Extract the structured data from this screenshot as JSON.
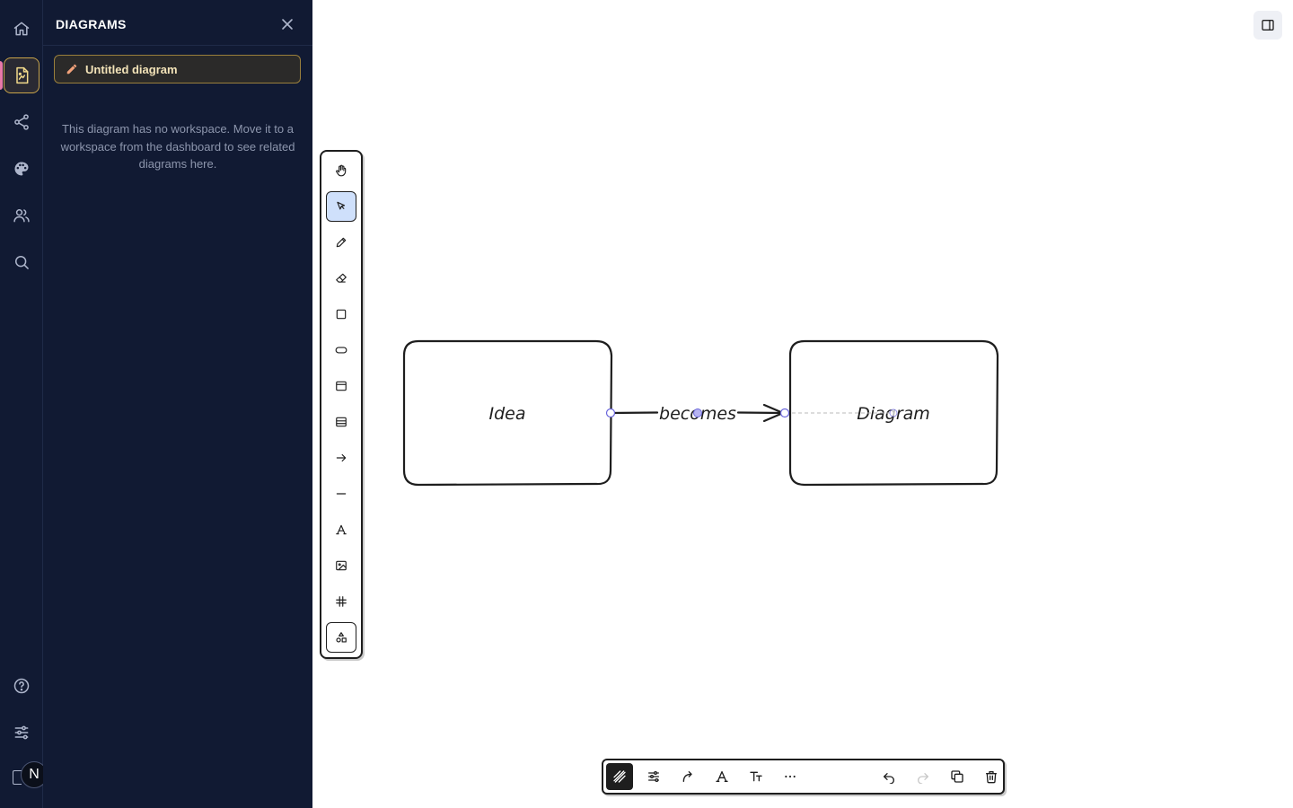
{
  "panel": {
    "title": "DIAGRAMS",
    "current_diagram": "Untitled diagram",
    "empty_message": "This diagram has no workspace. Move it to a workspace from the dashboard to see related diagrams here."
  },
  "user": {
    "avatar_initial": "N"
  },
  "rail": {
    "items": [
      "home-icon",
      "diagrams-icon",
      "share-icon",
      "palette-icon",
      "users-icon",
      "search-icon",
      "help-icon",
      "settings-icon"
    ],
    "active": "diagrams-icon"
  },
  "toolbar": {
    "tools": [
      "hand-tool",
      "select-tool",
      "pencil-tool",
      "eraser-tool",
      "rectangle-tool",
      "ellipse-tool",
      "frame-tool",
      "table-tool",
      "arrow-tool",
      "line-tool",
      "text-tool",
      "image-tool",
      "crop-tool",
      "shapes-library-tool"
    ],
    "selected": "select-tool"
  },
  "bottom_toolbar": {
    "items": [
      "fill-style-icon",
      "adjust-icon",
      "arrow-type-icon",
      "font-icon",
      "text-size-icon",
      "more-icon",
      "undo-icon",
      "redo-icon",
      "duplicate-icon",
      "delete-icon"
    ]
  },
  "diagram": {
    "nodes": [
      {
        "id": "idea",
        "label": "Idea"
      },
      {
        "id": "diagram",
        "label": "Diagram"
      }
    ],
    "edges": [
      {
        "from": "idea",
        "to": "diagram",
        "label": "becomes"
      }
    ],
    "colors": {
      "stroke": "#1e1e1e",
      "selection": "#6965db"
    }
  }
}
